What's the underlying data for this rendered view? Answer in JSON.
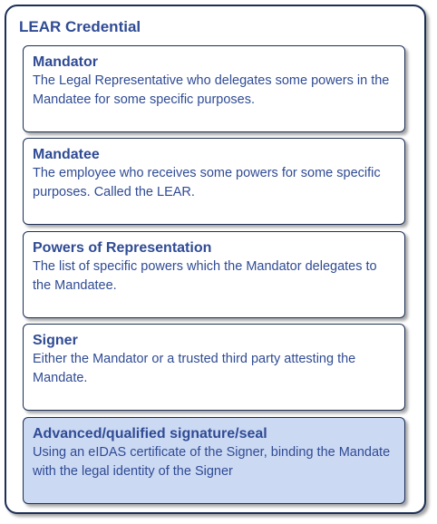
{
  "container": {
    "title": "LEAR Credential"
  },
  "cards": [
    {
      "title": "Mandator",
      "description": "The Legal Representative who delegates some powers in the Mandatee for some specific purposes.",
      "highlighted": false
    },
    {
      "title": "Mandatee",
      "description": "The employee who receives some powers for some specific purposes. Called the LEAR.",
      "highlighted": false
    },
    {
      "title": "Powers of Representation",
      "description": "The list of specific powers which the Mandator delegates to the Mandatee.",
      "highlighted": false
    },
    {
      "title": "Signer",
      "description": "Either the Mandator or a trusted third party attesting the Mandate.",
      "highlighted": false
    },
    {
      "title": "Advanced/qualified signature/seal",
      "description": "Using an eIDAS certificate of the Signer, binding the Mandate with the legal identity of the Signer",
      "highlighted": true
    }
  ],
  "colors": {
    "text": "#2f4b94",
    "border": "#1c2f55",
    "highlight_fill": "#ccd9f3"
  }
}
